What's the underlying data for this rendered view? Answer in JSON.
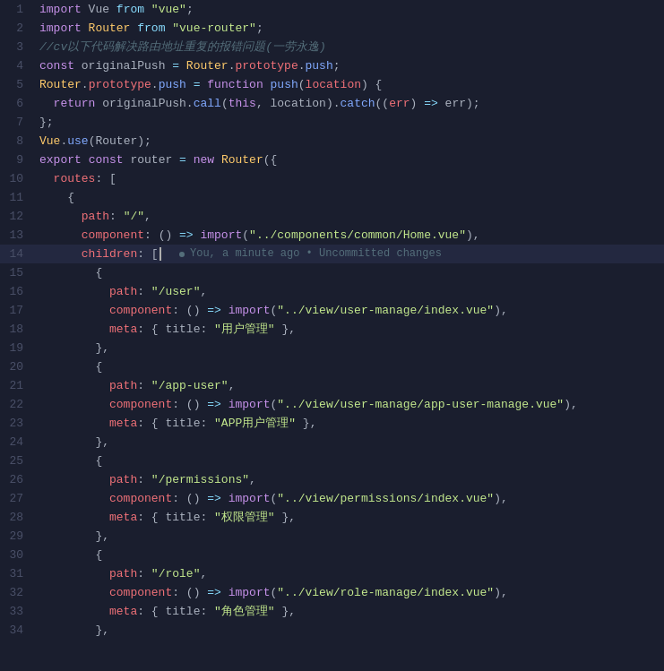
{
  "editor": {
    "background": "#1a1e2e",
    "lines": [
      {
        "number": 1,
        "tokens": [
          {
            "text": "import",
            "class": "kw"
          },
          {
            "text": " Vue ",
            "class": "plain"
          },
          {
            "text": "from",
            "class": "kw2"
          },
          {
            "text": " ",
            "class": "plain"
          },
          {
            "text": "\"vue\"",
            "class": "str"
          },
          {
            "text": ";",
            "class": "plain"
          }
        ]
      },
      {
        "number": 2,
        "tokens": [
          {
            "text": "import",
            "class": "kw"
          },
          {
            "text": " Router ",
            "class": "cls"
          },
          {
            "text": "from",
            "class": "kw2"
          },
          {
            "text": " ",
            "class": "plain"
          },
          {
            "text": "\"vue-router\"",
            "class": "str"
          },
          {
            "text": ";",
            "class": "plain"
          }
        ]
      },
      {
        "number": 3,
        "tokens": [
          {
            "text": "//cv以下代码解决路由地址重复的报错问题(一劳永逸)",
            "class": "comment"
          }
        ]
      },
      {
        "number": 4,
        "tokens": [
          {
            "text": "const",
            "class": "kw"
          },
          {
            "text": " originalPush ",
            "class": "plain"
          },
          {
            "text": "=",
            "class": "cyan"
          },
          {
            "text": " Router",
            "class": "cls"
          },
          {
            "text": ".",
            "class": "plain"
          },
          {
            "text": "prototype",
            "class": "red"
          },
          {
            "text": ".",
            "class": "plain"
          },
          {
            "text": "push",
            "class": "blue"
          },
          {
            "text": ";",
            "class": "plain"
          }
        ]
      },
      {
        "number": 5,
        "tokens": [
          {
            "text": "Router",
            "class": "cls"
          },
          {
            "text": ".",
            "class": "plain"
          },
          {
            "text": "prototype",
            "class": "red"
          },
          {
            "text": ".",
            "class": "plain"
          },
          {
            "text": "push",
            "class": "blue"
          },
          {
            "text": " ",
            "class": "plain"
          },
          {
            "text": "=",
            "class": "cyan"
          },
          {
            "text": " ",
            "class": "plain"
          },
          {
            "text": "function",
            "class": "kw"
          },
          {
            "text": " ",
            "class": "plain"
          },
          {
            "text": "push",
            "class": "blue"
          },
          {
            "text": "(",
            "class": "plain"
          },
          {
            "text": "location",
            "class": "red"
          },
          {
            "text": ") {",
            "class": "plain"
          }
        ]
      },
      {
        "number": 6,
        "tokens": [
          {
            "text": "  ",
            "class": "plain"
          },
          {
            "text": "return",
            "class": "kw"
          },
          {
            "text": " originalPush",
            "class": "plain"
          },
          {
            "text": ".",
            "class": "plain"
          },
          {
            "text": "call",
            "class": "blue"
          },
          {
            "text": "(",
            "class": "plain"
          },
          {
            "text": "this",
            "class": "kw"
          },
          {
            "text": ", location)",
            "class": "plain"
          },
          {
            "text": ".",
            "class": "plain"
          },
          {
            "text": "catch",
            "class": "blue"
          },
          {
            "text": "((",
            "class": "plain"
          },
          {
            "text": "err",
            "class": "red"
          },
          {
            "text": ") ",
            "class": "plain"
          },
          {
            "text": "=>",
            "class": "cyan"
          },
          {
            "text": " err)",
            "class": "plain"
          },
          {
            "text": ";",
            "class": "plain"
          }
        ]
      },
      {
        "number": 7,
        "tokens": [
          {
            "text": "};",
            "class": "plain"
          }
        ]
      },
      {
        "number": 8,
        "tokens": [
          {
            "text": "Vue",
            "class": "cls"
          },
          {
            "text": ".",
            "class": "plain"
          },
          {
            "text": "use",
            "class": "blue"
          },
          {
            "text": "(Router);",
            "class": "plain"
          }
        ]
      },
      {
        "number": 9,
        "tokens": [
          {
            "text": "export",
            "class": "kw"
          },
          {
            "text": " ",
            "class": "plain"
          },
          {
            "text": "const",
            "class": "kw"
          },
          {
            "text": " router ",
            "class": "plain"
          },
          {
            "text": "=",
            "class": "cyan"
          },
          {
            "text": " ",
            "class": "plain"
          },
          {
            "text": "new",
            "class": "kw"
          },
          {
            "text": " Router",
            "class": "cls"
          },
          {
            "text": "({",
            "class": "plain"
          }
        ]
      },
      {
        "number": 10,
        "tokens": [
          {
            "text": "  routes",
            "class": "red"
          },
          {
            "text": ": [",
            "class": "plain"
          }
        ]
      },
      {
        "number": 11,
        "tokens": [
          {
            "text": "    {",
            "class": "plain"
          }
        ]
      },
      {
        "number": 12,
        "tokens": [
          {
            "text": "      path",
            "class": "red"
          },
          {
            "text": ": ",
            "class": "plain"
          },
          {
            "text": "\"/\"",
            "class": "str"
          },
          {
            "text": ",",
            "class": "plain"
          }
        ]
      },
      {
        "number": 13,
        "tokens": [
          {
            "text": "      component",
            "class": "red"
          },
          {
            "text": ": () ",
            "class": "plain"
          },
          {
            "text": "=>",
            "class": "cyan"
          },
          {
            "text": " ",
            "class": "plain"
          },
          {
            "text": "import",
            "class": "kw"
          },
          {
            "text": "(",
            "class": "plain"
          },
          {
            "text": "\"../components/common/Home.vue\"",
            "class": "str"
          },
          {
            "text": "),",
            "class": "plain"
          }
        ]
      },
      {
        "number": 14,
        "active": true,
        "tokens": [
          {
            "text": "      children",
            "class": "red"
          },
          {
            "text": ": ",
            "class": "plain"
          },
          {
            "text": "[",
            "class": "plain"
          }
        ],
        "tooltip": "You, a minute ago • Uncommitted changes"
      },
      {
        "number": 15,
        "tokens": [
          {
            "text": "        {",
            "class": "plain"
          }
        ]
      },
      {
        "number": 16,
        "tokens": [
          {
            "text": "          path",
            "class": "red"
          },
          {
            "text": ": ",
            "class": "plain"
          },
          {
            "text": "\"/user\"",
            "class": "str"
          },
          {
            "text": ",",
            "class": "plain"
          }
        ]
      },
      {
        "number": 17,
        "tokens": [
          {
            "text": "          component",
            "class": "red"
          },
          {
            "text": ": () ",
            "class": "plain"
          },
          {
            "text": "=>",
            "class": "cyan"
          },
          {
            "text": " ",
            "class": "plain"
          },
          {
            "text": "import",
            "class": "kw"
          },
          {
            "text": "(",
            "class": "plain"
          },
          {
            "text": "\"../view/user-manage/index.vue\"",
            "class": "str"
          },
          {
            "text": "),",
            "class": "plain"
          }
        ]
      },
      {
        "number": 18,
        "tokens": [
          {
            "text": "          meta",
            "class": "red"
          },
          {
            "text": ": { title: ",
            "class": "plain"
          },
          {
            "text": "\"用户管理\"",
            "class": "str"
          },
          {
            "text": " },",
            "class": "plain"
          }
        ]
      },
      {
        "number": 19,
        "tokens": [
          {
            "text": "        },",
            "class": "plain"
          }
        ]
      },
      {
        "number": 20,
        "tokens": [
          {
            "text": "        {",
            "class": "plain"
          }
        ]
      },
      {
        "number": 21,
        "tokens": [
          {
            "text": "          path",
            "class": "red"
          },
          {
            "text": ": ",
            "class": "plain"
          },
          {
            "text": "\"/app-user\"",
            "class": "str"
          },
          {
            "text": ",",
            "class": "plain"
          }
        ]
      },
      {
        "number": 22,
        "tokens": [
          {
            "text": "          component",
            "class": "red"
          },
          {
            "text": ": () ",
            "class": "plain"
          },
          {
            "text": "=>",
            "class": "cyan"
          },
          {
            "text": " ",
            "class": "plain"
          },
          {
            "text": "import",
            "class": "kw"
          },
          {
            "text": "(",
            "class": "plain"
          },
          {
            "text": "\"../view/user-manage/app-user-manage.vue\"",
            "class": "str"
          },
          {
            "text": "),",
            "class": "plain"
          }
        ]
      },
      {
        "number": 23,
        "tokens": [
          {
            "text": "          meta",
            "class": "red"
          },
          {
            "text": ": { title: ",
            "class": "plain"
          },
          {
            "text": "\"APP用户管理\"",
            "class": "str"
          },
          {
            "text": " },",
            "class": "plain"
          }
        ]
      },
      {
        "number": 24,
        "tokens": [
          {
            "text": "        },",
            "class": "plain"
          }
        ]
      },
      {
        "number": 25,
        "tokens": [
          {
            "text": "        {",
            "class": "plain"
          }
        ]
      },
      {
        "number": 26,
        "tokens": [
          {
            "text": "          path",
            "class": "red"
          },
          {
            "text": ": ",
            "class": "plain"
          },
          {
            "text": "\"/permissions\"",
            "class": "str"
          },
          {
            "text": ",",
            "class": "plain"
          }
        ]
      },
      {
        "number": 27,
        "tokens": [
          {
            "text": "          component",
            "class": "red"
          },
          {
            "text": ": () ",
            "class": "plain"
          },
          {
            "text": "=>",
            "class": "cyan"
          },
          {
            "text": " ",
            "class": "plain"
          },
          {
            "text": "import",
            "class": "kw"
          },
          {
            "text": "(",
            "class": "plain"
          },
          {
            "text": "\"../view/permissions/index.vue\"",
            "class": "str"
          },
          {
            "text": "),",
            "class": "plain"
          }
        ]
      },
      {
        "number": 28,
        "tokens": [
          {
            "text": "          meta",
            "class": "red"
          },
          {
            "text": ": { title: ",
            "class": "plain"
          },
          {
            "text": "\"权限管理\"",
            "class": "str"
          },
          {
            "text": " },",
            "class": "plain"
          }
        ]
      },
      {
        "number": 29,
        "tokens": [
          {
            "text": "        },",
            "class": "plain"
          }
        ]
      },
      {
        "number": 30,
        "tokens": [
          {
            "text": "        {",
            "class": "plain"
          }
        ]
      },
      {
        "number": 31,
        "tokens": [
          {
            "text": "          path",
            "class": "red"
          },
          {
            "text": ": ",
            "class": "plain"
          },
          {
            "text": "\"/role\"",
            "class": "str"
          },
          {
            "text": ",",
            "class": "plain"
          }
        ]
      },
      {
        "number": 32,
        "tokens": [
          {
            "text": "          component",
            "class": "red"
          },
          {
            "text": ": () ",
            "class": "plain"
          },
          {
            "text": "=>",
            "class": "cyan"
          },
          {
            "text": " ",
            "class": "plain"
          },
          {
            "text": "import",
            "class": "kw"
          },
          {
            "text": "(",
            "class": "plain"
          },
          {
            "text": "\"../view/role-manage/index.vue\"",
            "class": "str"
          },
          {
            "text": "),",
            "class": "plain"
          }
        ]
      },
      {
        "number": 33,
        "tokens": [
          {
            "text": "          meta",
            "class": "red"
          },
          {
            "text": ": { title: ",
            "class": "plain"
          },
          {
            "text": "\"角色管理\"",
            "class": "str"
          },
          {
            "text": " },",
            "class": "plain"
          }
        ]
      },
      {
        "number": 34,
        "tokens": [
          {
            "text": "        },",
            "class": "plain"
          }
        ]
      }
    ]
  }
}
